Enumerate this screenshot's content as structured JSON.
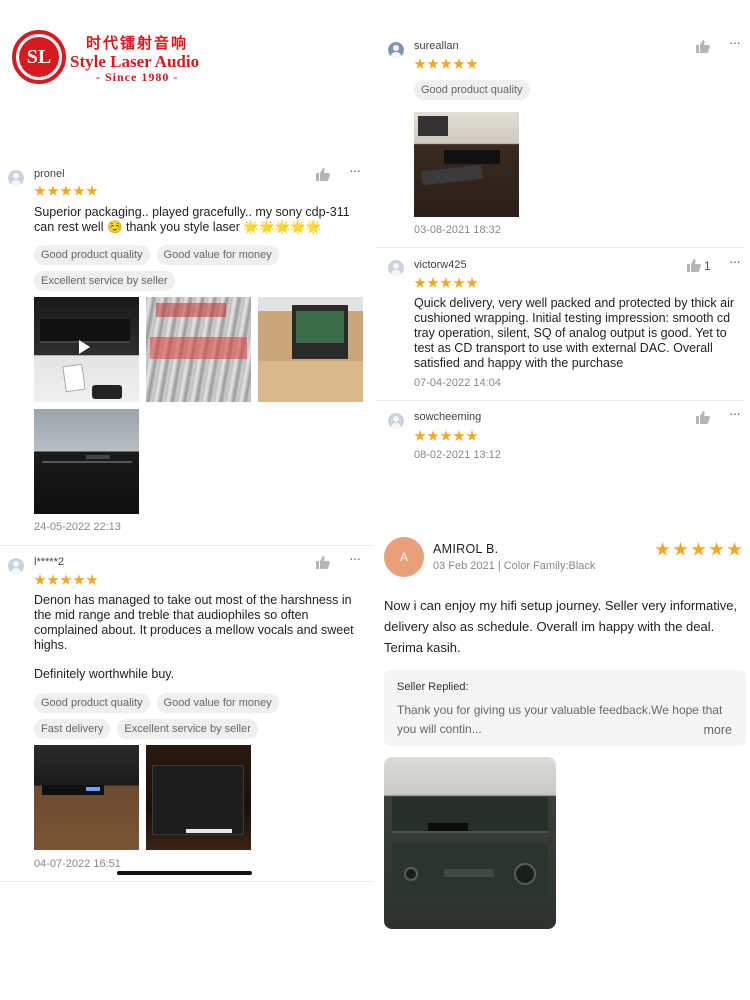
{
  "brand": {
    "chinese_name": "时代镭射音响",
    "english_name": "Style Laser Audio",
    "since": "- Since 1980 -",
    "colors": {
      "brand_red": "#d71920"
    }
  },
  "left_reviews": [
    {
      "username": "pronel",
      "rating": 5,
      "text": "Superior packaging.. played gracefully.. my sony cdp-311 can rest well ☺️ thank you style laser 🌟🌟🌟🌟🌟",
      "tags": [
        "Good product quality",
        "Good value for money",
        "Excellent service by seller"
      ],
      "date": "24-05-2022 22:13"
    },
    {
      "username": "l*****2",
      "rating": 5,
      "text": "Denon has managed to take out most of the harshness in the mid range and treble that audiophiles so often complained about. It produces a mellow vocals and sweet highs.",
      "text2": "Definitely worthwhile buy.",
      "tags": [
        "Good product quality",
        "Good value for money",
        "Fast delivery",
        "Excellent service by seller"
      ],
      "date": "04-07-2022 16:51"
    }
  ],
  "right_reviews": [
    {
      "username": "sureallan",
      "rating": 5,
      "tags": [
        "Good product quality"
      ],
      "date": "03-08-2021 18:32"
    },
    {
      "username": "victorw425",
      "rating": 5,
      "likes": "1",
      "text": "Quick delivery, very well packed and protected by thick air cushioned wrapping. Initial testing impression: smooth cd tray operation, silent, SQ of analog output is good. Yet to test as CD transport to use with external DAC. Overall satisfied and happy with the purchase",
      "date": "07-04-2022 14:04"
    },
    {
      "username": "sowcheeming",
      "rating": 5,
      "date": "08-02-2021 13:12"
    }
  ],
  "featured_review": {
    "avatar_letter": "A",
    "name": "AMIROL B.",
    "meta": "03 Feb 2021 | Color Family:Black",
    "rating": 5,
    "text": "Now i can enjoy my hifi setup journey. Seller very informative, delivery also as schedule. Overall im happy with the deal. Terima kasih.",
    "seller_reply_title": "Seller Replied:",
    "seller_reply_text": "Thank you for giving us your valuable feedback.We hope that you will contin...",
    "more_label": "more"
  },
  "icons": {
    "like": "thumbs-up-icon",
    "more": "more-dots-icon",
    "avatar": "user-avatar-icon",
    "star": "star-icon",
    "play": "play-icon"
  },
  "colors": {
    "star": "#f5a623",
    "avatar_featured": "#e8a07a"
  }
}
